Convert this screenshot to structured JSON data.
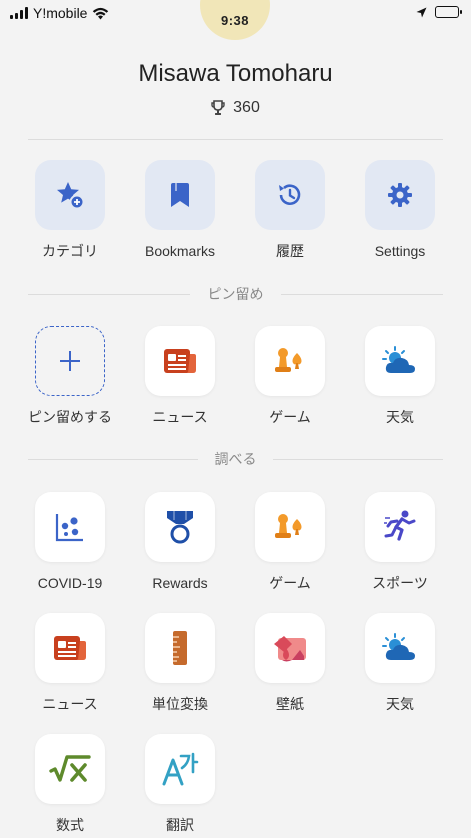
{
  "status": {
    "carrier": "Y!mobile"
  },
  "avatar": {
    "time_text": "9:38"
  },
  "profile": {
    "name": "Misawa Tomoharu",
    "points": "360"
  },
  "quick_actions": [
    {
      "label": "カテゴリ",
      "icon": "star-plus-icon"
    },
    {
      "label": "Bookmarks",
      "icon": "bookmark-icon"
    },
    {
      "label": "履歴",
      "icon": "history-icon"
    },
    {
      "label": "Settings",
      "icon": "gear-icon"
    }
  ],
  "pinned": {
    "title": "ピン留め",
    "items": [
      {
        "label": "ピン留めする",
        "icon": "plus-icon"
      },
      {
        "label": "ニュース",
        "icon": "news-icon"
      },
      {
        "label": "ゲーム",
        "icon": "game-icon"
      },
      {
        "label": "天気",
        "icon": "weather-icon"
      }
    ]
  },
  "explore": {
    "title": "調べる",
    "items": [
      {
        "label": "COVID-19",
        "icon": "covid-chart-icon"
      },
      {
        "label": "Rewards",
        "icon": "medal-icon"
      },
      {
        "label": "ゲーム",
        "icon": "game-icon"
      },
      {
        "label": "スポーツ",
        "icon": "running-icon"
      },
      {
        "label": "ニュース",
        "icon": "news-icon"
      },
      {
        "label": "単位変換",
        "icon": "ruler-icon"
      },
      {
        "label": "壁紙",
        "icon": "wallpaper-icon"
      },
      {
        "label": "天気",
        "icon": "weather-icon"
      },
      {
        "label": "数式",
        "icon": "math-icon"
      },
      {
        "label": "翻訳",
        "icon": "translate-icon"
      }
    ]
  },
  "colors": {
    "accent": "#3b64c8",
    "quick_tile": "#e2e8f3",
    "background": "#f3f3f3"
  }
}
